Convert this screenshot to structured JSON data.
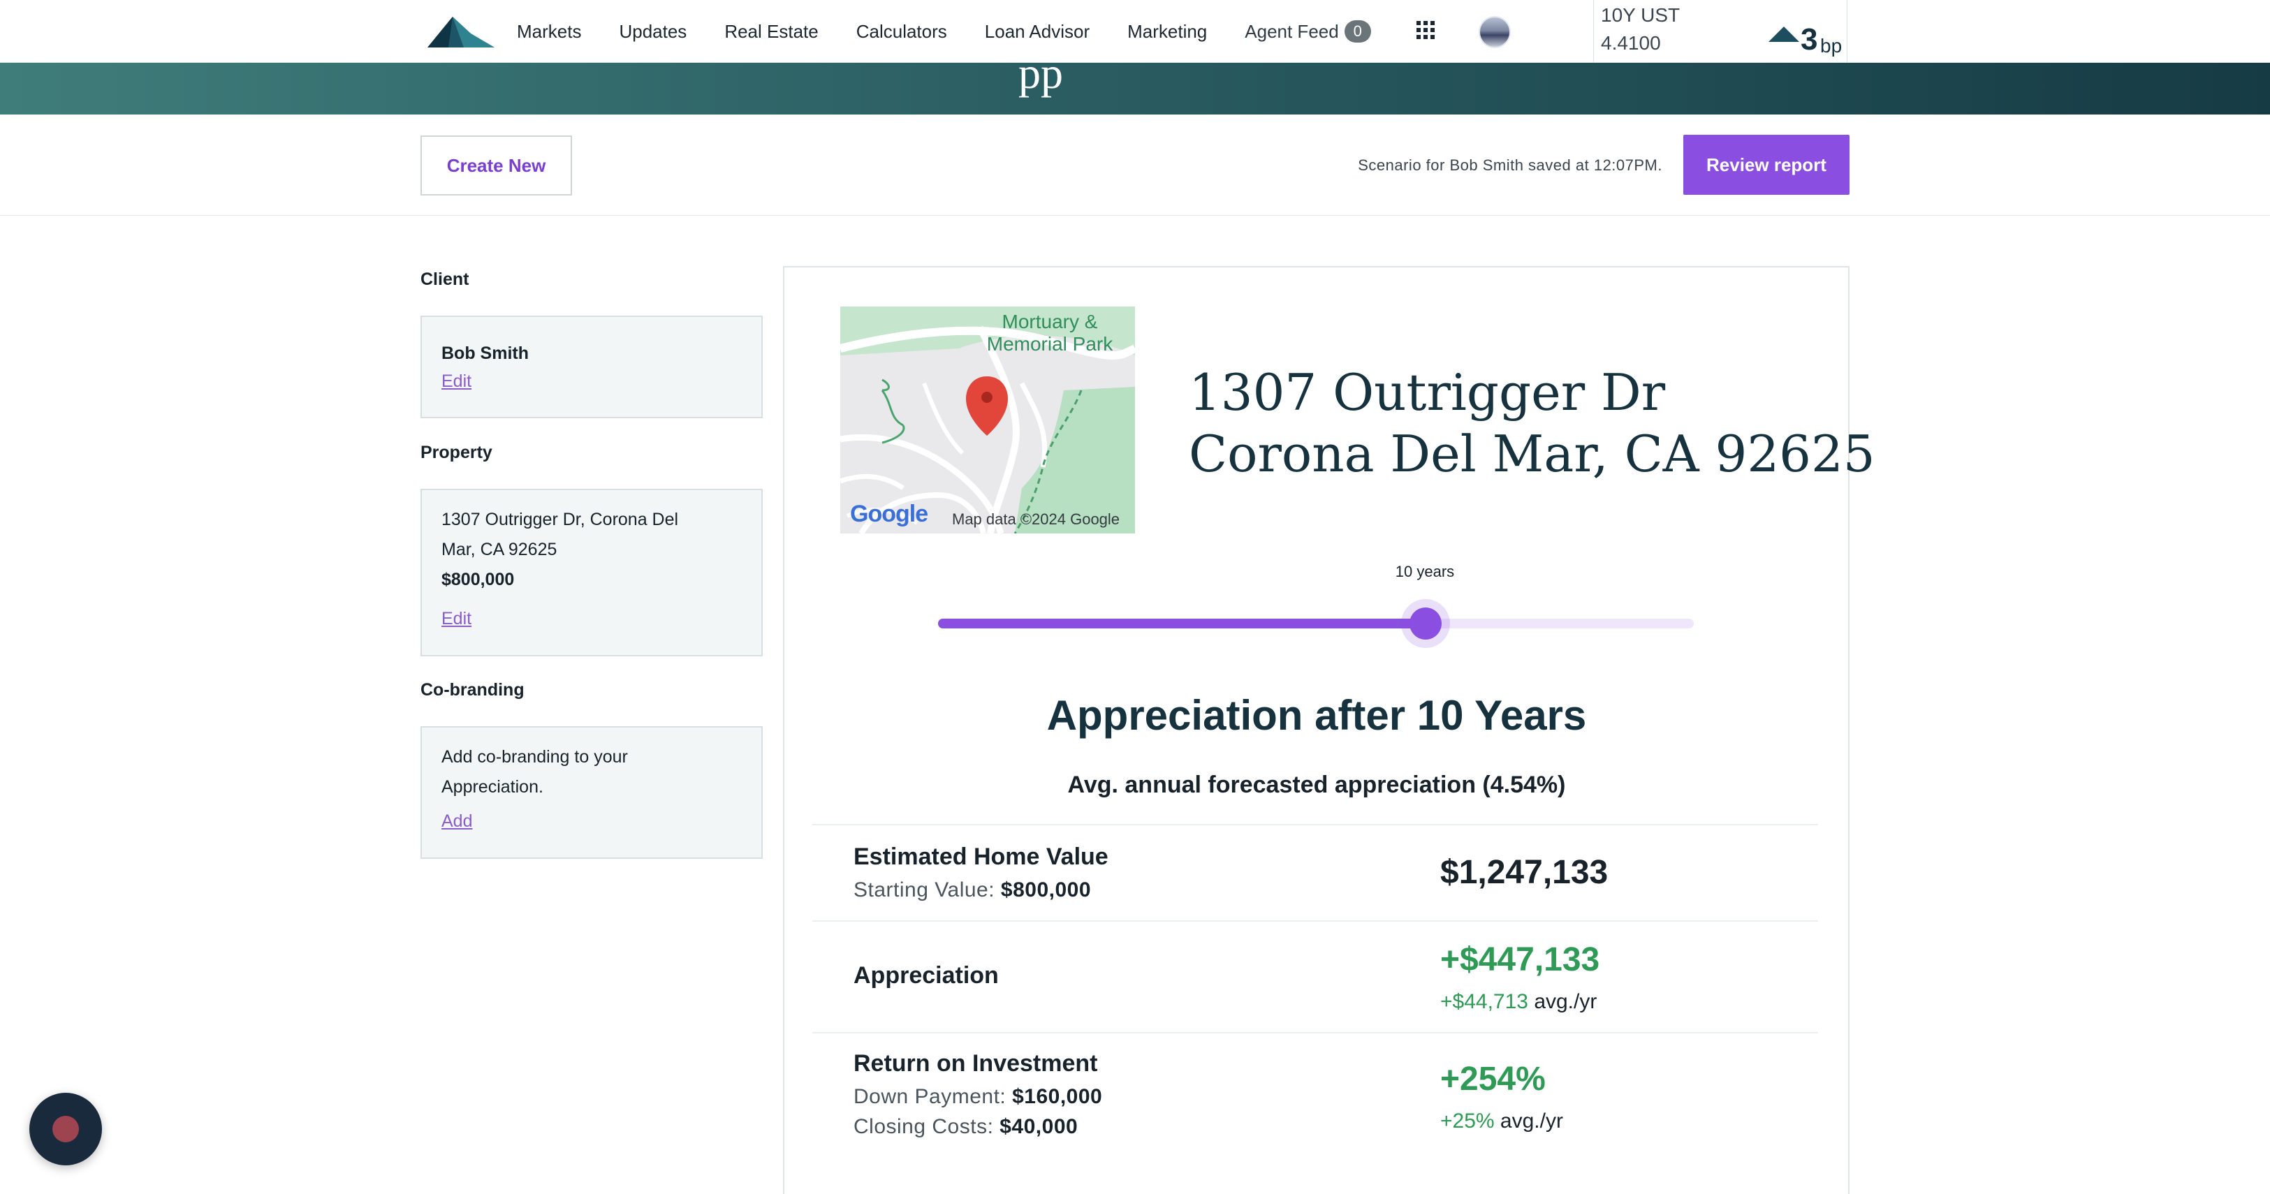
{
  "nav": {
    "items": [
      "Markets",
      "Updates",
      "Real Estate",
      "Calculators",
      "Loan Advisor",
      "Marketing"
    ],
    "agent_feed_label": "Agent Feed",
    "agent_feed_count": "0",
    "ticker": {
      "label": "10Y UST",
      "value": "4.4100",
      "change": "3",
      "unit": "bp",
      "direction": "up"
    }
  },
  "banner": {
    "glyph": "pp"
  },
  "actions": {
    "create_label": "Create New",
    "saved_message": "Scenario for Bob Smith saved at 12:07PM.",
    "review_label": "Review report"
  },
  "sidebar": {
    "client": {
      "heading": "Client",
      "name": "Bob Smith",
      "edit_label": "Edit"
    },
    "property": {
      "heading": "Property",
      "address_line1": "1307 Outrigger Dr, Corona Del",
      "address_line2": "Mar, CA 92625",
      "price": "$800,000",
      "edit_label": "Edit"
    },
    "cobranding": {
      "heading": "Co-branding",
      "text_line1": "Add co-branding to your",
      "text_line2": "Appreciation.",
      "add_label": "Add"
    }
  },
  "map": {
    "poi_line1": "Mortuary &",
    "poi_line2": "Memorial Park",
    "attribution": "Map data ©2024 Google",
    "google_logo": "Google"
  },
  "property_header": {
    "line1": "1307 Outrigger Dr",
    "line2": "Corona Del Mar, CA 92625"
  },
  "slider": {
    "label": "10 years",
    "value_fraction": 0.645
  },
  "results": {
    "title": "Appreciation after 10 Years",
    "subtitle": "Avg. annual forecasted appreciation (4.54%)",
    "home_value": {
      "label": "Estimated Home Value",
      "start_label": "Starting Value:",
      "start_value": "$800,000",
      "value": "$1,247,133"
    },
    "appreciation": {
      "label": "Appreciation",
      "value": "+$447,133",
      "per_year": "+$44,713",
      "per_year_suffix": "avg./yr"
    },
    "roi": {
      "label": "Return on Investment",
      "down_label": "Down Payment:",
      "down_value": "$160,000",
      "closing_label": "Closing Costs:",
      "closing_value": "$40,000",
      "value": "+254%",
      "per_year": "+25%",
      "per_year_suffix": "avg./yr"
    }
  },
  "colors": {
    "accent": "#8a4ee0",
    "positive": "#2f9a55",
    "brand": "#17323f"
  }
}
